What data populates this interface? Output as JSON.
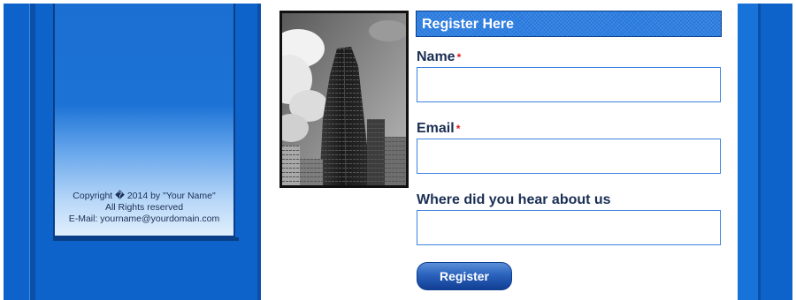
{
  "footer": {
    "copyright": "Copyright � 2014 by \"Your Name\"",
    "rights": "All Rights reserved",
    "email": "E-Mail: yourname@yourdomain.com"
  },
  "photo": {
    "icon": "skyscraper-photo"
  },
  "form": {
    "header": "Register Here",
    "fields": [
      {
        "label": "Name",
        "required_mark": "*",
        "value": ""
      },
      {
        "label": "Email",
        "required_mark": "*",
        "value": ""
      },
      {
        "label": "Where did you hear about us",
        "value": ""
      }
    ],
    "submit_label": "Register"
  },
  "colors": {
    "column_blue": "#0d63c9",
    "header_blue": "#2477dd",
    "label_text": "#1b2f55",
    "required": "#e01a1a",
    "button_blue": "#2a62bd"
  }
}
